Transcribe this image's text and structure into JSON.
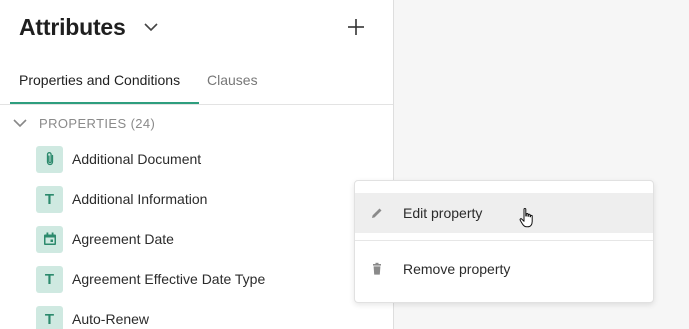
{
  "header": {
    "title": "Attributes"
  },
  "tabs": [
    {
      "label": "Properties and Conditions"
    },
    {
      "label": "Clauses"
    }
  ],
  "section": {
    "label": "PROPERTIES (24)"
  },
  "properties": [
    {
      "label": "Additional Document",
      "icon": "paperclip-icon"
    },
    {
      "label": "Additional Information",
      "icon": "text-type-icon",
      "glyph": "T"
    },
    {
      "label": "Agreement Date",
      "icon": "calendar-icon"
    },
    {
      "label": "Agreement Effective Date Type",
      "icon": "text-type-icon",
      "glyph": "T"
    },
    {
      "label": "Auto-Renew",
      "icon": "text-type-icon",
      "glyph": "T"
    }
  ],
  "context_menu": {
    "items": [
      {
        "label": "Edit property",
        "icon": "pencil-icon"
      },
      {
        "label": "Remove property",
        "icon": "trash-icon"
      }
    ]
  },
  "colors": {
    "accent": "#2e9e7e",
    "badge_bg": "#cfe9e1",
    "badge_fg": "#2c8a6d"
  }
}
